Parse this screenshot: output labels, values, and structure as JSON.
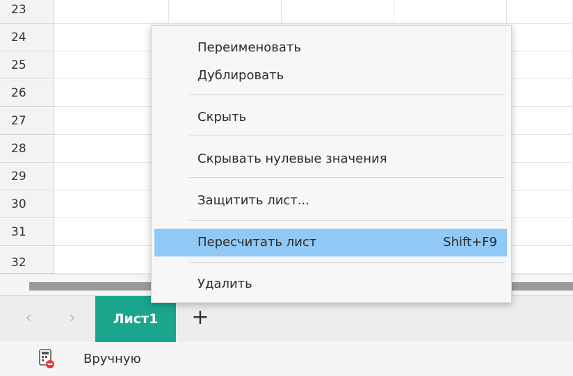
{
  "grid": {
    "rows": [
      "23",
      "24",
      "25",
      "26",
      "27",
      "28",
      "29",
      "30",
      "31",
      "32"
    ]
  },
  "tabs": {
    "prev_icon": "chevron-left-icon",
    "next_icon": "chevron-right-icon",
    "prev_glyph": "‹",
    "next_glyph": "›",
    "active_tab": "Лист1",
    "add_glyph": "+"
  },
  "status_bar": {
    "calc_mode": "Вручную"
  },
  "context_menu": {
    "items": [
      {
        "label": "Переименовать"
      },
      {
        "label": "Дублировать"
      },
      {
        "label": "Скрыть"
      },
      {
        "label": "Скрывать нулевые значения"
      },
      {
        "label": "Защитить лист..."
      },
      {
        "label": "Пересчитать лист",
        "shortcut": "Shift+F9"
      },
      {
        "label": "Удалить"
      }
    ]
  },
  "colors": {
    "active_tab_bg": "#1aa68c",
    "menu_highlight": "#90c8f6"
  }
}
